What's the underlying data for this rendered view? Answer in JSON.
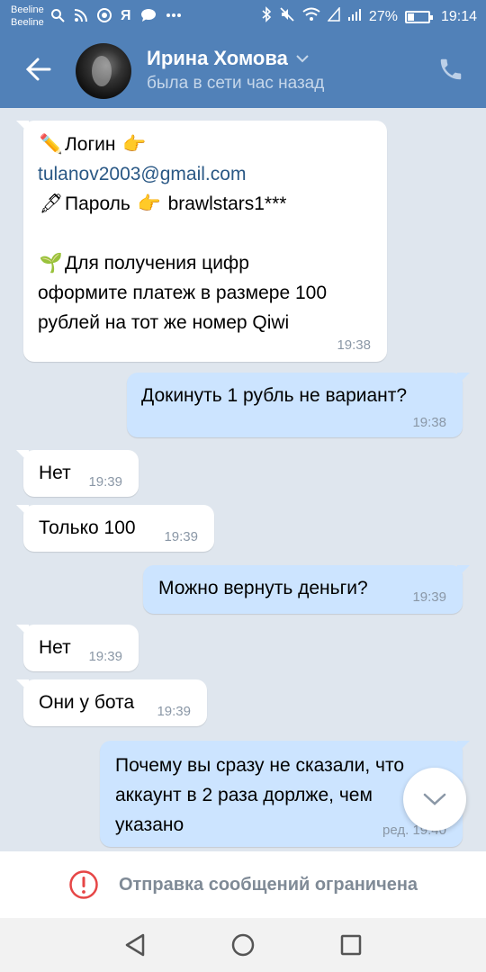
{
  "status_bar": {
    "carrier1": "Beeline",
    "carrier2": "Beeline",
    "battery": "27%",
    "time": "19:14"
  },
  "header": {
    "name": "Ирина Хомова",
    "status": "была в сети час назад"
  },
  "messages": [
    {
      "direction": "in",
      "login_label": "Логин",
      "email": "tulanov2003@gmail.com",
      "password_label": "Пароль",
      "password": "brawlstars1***",
      "line1": "Для получения цифр",
      "line2": "оформите платеж в размере 100",
      "line3": "рублей на тот же номер Qiwi",
      "time": "19:38"
    },
    {
      "direction": "out",
      "text": "Докинуть 1 рубль не вариант?",
      "time": "19:38"
    },
    {
      "direction": "in",
      "text": "Нет",
      "time": "19:39"
    },
    {
      "direction": "in",
      "text": "Только 100",
      "time": "19:39"
    },
    {
      "direction": "out",
      "text": "Можно вернуть деньги?",
      "time": "19:39"
    },
    {
      "direction": "in",
      "text": "Нет",
      "time": "19:39"
    },
    {
      "direction": "in",
      "text": "Они у бота",
      "time": "19:39"
    },
    {
      "direction": "out",
      "line1": "Почему вы сразу не сказали, что",
      "line2": "аккаунт в 2 раза дорлже, чем",
      "line3": "указано",
      "time": "ред. 19:40"
    }
  ],
  "restriction": {
    "text": "Отправка сообщений ограничена"
  },
  "colors": {
    "header": "#5181b8",
    "incoming_bubble": "#ffffff",
    "outgoing_bubble": "#cce4ff",
    "background": "#dfe6ee",
    "warning": "#e64646"
  }
}
